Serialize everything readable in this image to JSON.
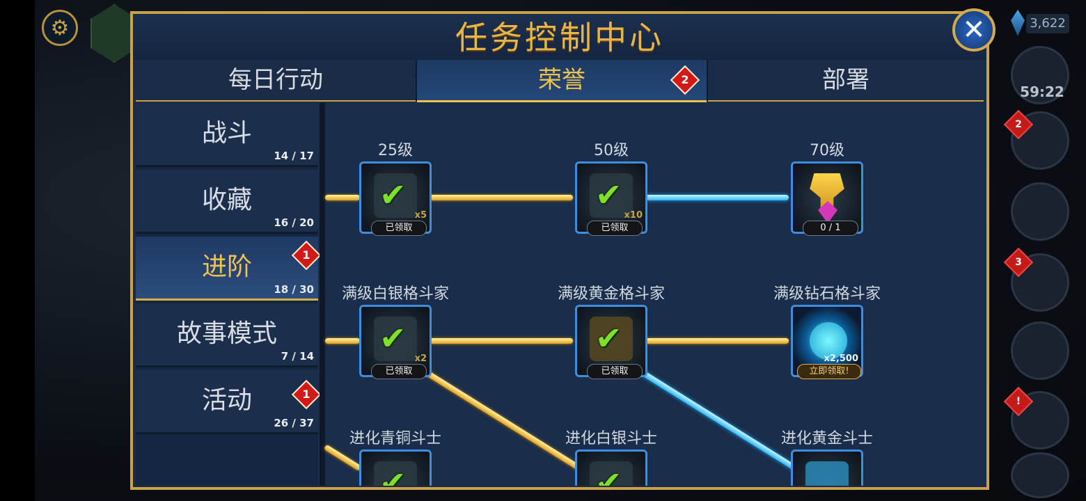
{
  "hud": {
    "currency_value": "3,622",
    "timer": "59:22",
    "side_badges": [
      "2",
      "3",
      "!"
    ]
  },
  "panel": {
    "title": "任务控制中心",
    "close_icon": "close-icon"
  },
  "tabs": [
    {
      "label": "每日行动",
      "active": false
    },
    {
      "label": "荣誉",
      "active": true,
      "badge": "2"
    },
    {
      "label": "部署",
      "active": false
    }
  ],
  "categories": [
    {
      "label": "战斗",
      "count": "14 / 17",
      "active": false
    },
    {
      "label": "收藏",
      "count": "16 / 20",
      "active": false
    },
    {
      "label": "进阶",
      "count": "18 / 30",
      "active": true,
      "badge": "1"
    },
    {
      "label": "故事模式",
      "count": "7 / 14",
      "active": false
    },
    {
      "label": "活动",
      "count": "26 / 37",
      "active": false,
      "badge": "1"
    }
  ],
  "tree": {
    "row1": [
      {
        "label": "25级",
        "status": "已领取",
        "mult": "x5",
        "icon": "statue-icon"
      },
      {
        "label": "50级",
        "status": "已领取",
        "mult": "x10",
        "icon": "hourglass-icon"
      },
      {
        "label": "70级",
        "status": "0 / 1",
        "mult": "",
        "icon": "trophy-icon"
      }
    ],
    "row2": [
      {
        "label": "满级白银格斗家",
        "status": "已领取",
        "mult": "x2",
        "icon": "fighter-icon"
      },
      {
        "label": "满级黄金格斗家",
        "status": "已领取",
        "mult": "",
        "icon": "fighter-icon"
      },
      {
        "label": "满级钻石格斗家",
        "status": "立即领取!",
        "mult": "x2,500",
        "icon": "theonite-icon"
      }
    ],
    "row3": [
      {
        "label": "进化青铜斗士",
        "icon": "fighter-icon"
      },
      {
        "label": "进化白银斗士",
        "icon": "fighter-icon"
      },
      {
        "label": "进化黄金斗士",
        "icon": "xp-icon"
      }
    ]
  },
  "colors": {
    "gold": "#c9a24a",
    "title_gold": "#e8b54a",
    "panel_bg": "#1a2c48",
    "gold_line": "#e3a21c",
    "blue_line": "#2eb6f2",
    "badge_red": "#d31818",
    "check_green": "#7ee02b"
  }
}
